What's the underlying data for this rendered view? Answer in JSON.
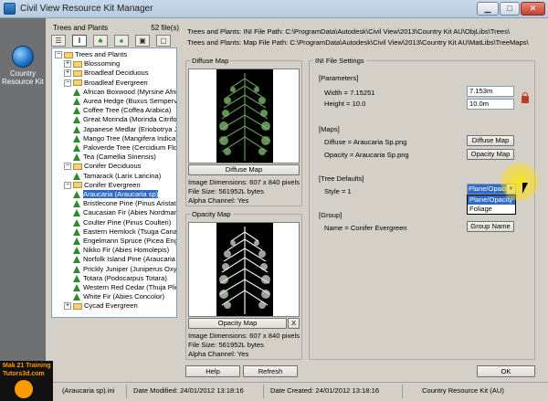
{
  "window": {
    "title": "Civil View Resource Kit Manager",
    "min_glyph": "▁",
    "max_glyph": "□",
    "close_glyph": "✕"
  },
  "nav": {
    "item_label": "Country Resource Kit"
  },
  "tree_panel": {
    "title": "Trees and Plants",
    "count": "52 file(s)",
    "toolbar_icons": [
      "list-icon",
      "column-icon",
      "tree-icon",
      "palm-icon",
      "image-icon",
      "blank-icon"
    ],
    "toolbar_glyphs": [
      "☰",
      "‖",
      "♣",
      "♠",
      "▣",
      "▢"
    ],
    "items": [
      {
        "label": "Trees and Plants",
        "level": 0,
        "type": "folder",
        "expander": "−"
      },
      {
        "label": "Blossoming",
        "level": 1,
        "type": "folder",
        "expander": "+"
      },
      {
        "label": "Broadleaf Deciduous",
        "level": 1,
        "type": "folder",
        "expander": "+"
      },
      {
        "label": "Broadleaf Evergreen",
        "level": 1,
        "type": "folder",
        "expander": "−"
      },
      {
        "label": "African Boxwood (Myrsine Afric",
        "level": 2,
        "type": "tree"
      },
      {
        "label": "Aurea Hedge (Buxus Sempervir",
        "level": 2,
        "type": "tree"
      },
      {
        "label": "Coffee Tree (Coffea Arabica)",
        "level": 2,
        "type": "tree"
      },
      {
        "label": "Great Morinda (Morinda Citrifoli",
        "level": 2,
        "type": "tree"
      },
      {
        "label": "Japanese Medlar (Eriobotrya Ja",
        "level": 2,
        "type": "tree"
      },
      {
        "label": "Mango Tree (Mangifera Indica)",
        "level": 2,
        "type": "tree"
      },
      {
        "label": "Paloverde Tree (Cercidium Flori",
        "level": 2,
        "type": "tree"
      },
      {
        "label": "Tea (Camellia Sinensis)",
        "level": 2,
        "type": "tree"
      },
      {
        "label": "Conifer Deciduous",
        "level": 1,
        "type": "folder",
        "expander": "−"
      },
      {
        "label": "Tamarack (Larix Laricina)",
        "level": 2,
        "type": "tree"
      },
      {
        "label": "Conifer Evergreen",
        "level": 1,
        "type": "folder",
        "expander": "−"
      },
      {
        "label": "Araucaria (Araucaria sp)",
        "level": 2,
        "type": "tree",
        "selected": true
      },
      {
        "label": "Bristlecone Pine (Pinus Aristata",
        "level": 2,
        "type": "tree"
      },
      {
        "label": "Caucasian Fir (Abies Nordmann",
        "level": 2,
        "type": "tree"
      },
      {
        "label": "Coulter Pine (Pinus Coulteri)",
        "level": 2,
        "type": "tree"
      },
      {
        "label": "Eastern Hemlock (Tsuga Canad",
        "level": 2,
        "type": "tree"
      },
      {
        "label": "Engelmann Spruce (Picea Engel",
        "level": 2,
        "type": "tree"
      },
      {
        "label": "Nikko Fir (Abies Homolepis)",
        "level": 2,
        "type": "tree"
      },
      {
        "label": "Norfolk Island Pine (Araucaria h",
        "level": 2,
        "type": "tree"
      },
      {
        "label": "Prickly Juniper (Juniperus Oxyc",
        "level": 2,
        "type": "tree"
      },
      {
        "label": "Totara (Podocarpus Totara)",
        "level": 2,
        "type": "tree"
      },
      {
        "label": "Western Red Cedar (Thuja Plic",
        "level": 2,
        "type": "tree"
      },
      {
        "label": "White Fir (Abies Concolor)",
        "level": 2,
        "type": "tree"
      },
      {
        "label": "Cycad Evergreen",
        "level": 1,
        "type": "folder",
        "expander": "+"
      }
    ]
  },
  "paths": {
    "ini_path": "Trees and Plants: INI File Path: C:\\ProgramData\\Autodesk\\Civil View\\2013\\Country Kit AU\\ObjLibs\\Trees\\",
    "map_path": "Trees and Plants: Map File Path: C:\\ProgramData\\Autodesk\\Civil View\\2013\\Country Kit AU\\MatLibs\\TreeMaps\\"
  },
  "diffuse_map": {
    "group_label": "Diffuse Map",
    "button_label": "Diffuse Map",
    "dimensions": "Image Dimensions: 607 x 840 pixels",
    "file_size": "File Size: 561952L bytes",
    "alpha": "Alpha Channel: Yes"
  },
  "opacity_map": {
    "group_label": "Opacity Map",
    "button_label": "Opacity Map",
    "clear_label": "X",
    "dimensions": "Image Dimensions: 607 x 840 pixels",
    "file_size": "File Size: 561952L bytes",
    "alpha": "Alpha Channel: Yes"
  },
  "ini_settings": {
    "group_label": "INI File Settings",
    "parameters_header": "[Parameters]",
    "width_text": "Width = 7.15251",
    "height_text": "Height = 10.0",
    "width_value": "7.153m",
    "height_value": "10.0m",
    "maps_header": "[Maps]",
    "diffuse_text": "Diffuse = Araucaria Sp.png",
    "opacity_text": "Opacity = Araucaria Sp.png",
    "diffuse_button": "Diffuse Map",
    "opacity_button": "Opacity Map",
    "tree_defaults_header": "[Tree Defaults]",
    "style_text": "Style = 1",
    "style_selected": "Plane/Opaci",
    "style_options": [
      "Plane/Opacity",
      "Foliage"
    ],
    "group_header": "[Group]",
    "name_text": "Name = Conifer Evergreen",
    "group_name_button": "Group Name"
  },
  "buttons": {
    "help": "Help",
    "refresh": "Refresh",
    "ok": "OK"
  },
  "status_bar": {
    "file": "(Araucaria sp).ini",
    "modified": "Date Modified: 24/01/2012 13:18:16",
    "created": "Date Created: 24/01/2012 13:18:16",
    "kit": "Country Resource Kit (AU)"
  },
  "watermark": {
    "line1": "Mak 21 Training",
    "line2": "Tutors3d.com"
  }
}
